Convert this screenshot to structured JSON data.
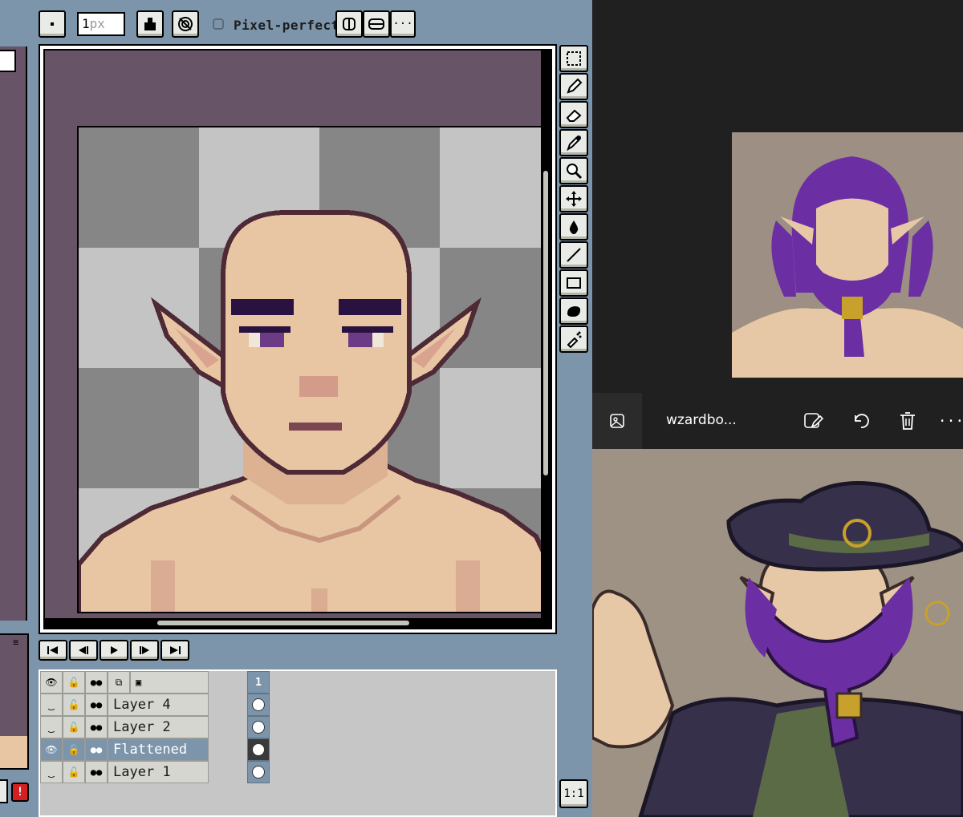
{
  "editor": {
    "top_bar": {
      "brush_size_value": "1",
      "brush_size_placeholder": "px",
      "pixel_perfect_label": "Pixel-perfect",
      "more_label": "···"
    },
    "layers": [
      {
        "name": "Layer 4",
        "visible": false,
        "selected": false
      },
      {
        "name": "Layer 2",
        "visible": false,
        "selected": false
      },
      {
        "name": "Flattened",
        "visible": true,
        "selected": true
      },
      {
        "name": "Layer 1",
        "visible": false,
        "selected": false
      }
    ],
    "frame_number": "1",
    "ratio_label": "1:1",
    "warning_label": "!",
    "menu_glyph": "≡"
  },
  "viewer": {
    "file_title": "wzardbo...",
    "more_label": "···"
  },
  "colors": {
    "editor_bg": "#7d95ab",
    "canvas_bg": "#675466",
    "skin": "#e8c5a3",
    "outline": "#4d2a36",
    "hair": "#6b2fa3",
    "viewer_bg": "#202020"
  }
}
